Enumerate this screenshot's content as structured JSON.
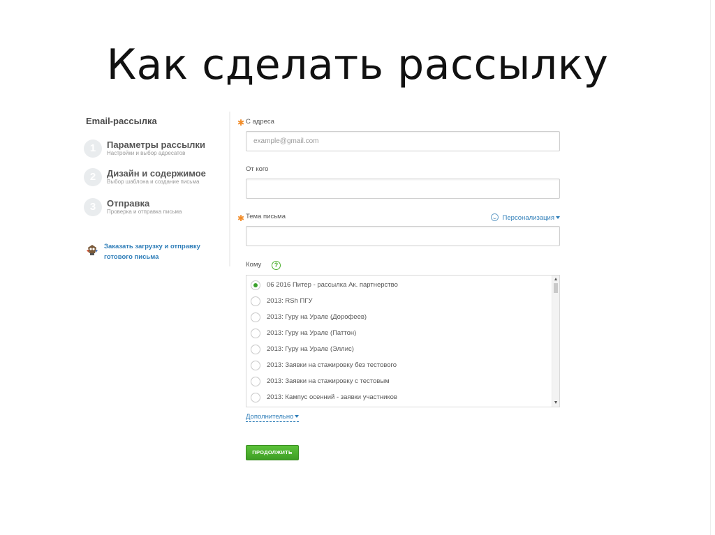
{
  "slide": {
    "title": "Как сделать рассылку"
  },
  "sidebar": {
    "title": "Email-рассылка",
    "steps": [
      {
        "number": "1",
        "title": "Параметры рассылки",
        "subtitle": "Настройки и выбор адресатов"
      },
      {
        "number": "2",
        "title": "Дизайн и содержимое",
        "subtitle": "Выбор шаблона и создание письма"
      },
      {
        "number": "3",
        "title": "Отправка",
        "subtitle": "Проверка и отправка письма"
      }
    ],
    "order_link": {
      "line1": "Заказать загрузку и отправку",
      "line2": "готового письма",
      "icon": "robot-icon"
    }
  },
  "form": {
    "from_address": {
      "label": "С адреса",
      "placeholder": "example@gmail.com",
      "required": true
    },
    "from_name": {
      "label": "От кого",
      "value": ""
    },
    "subject": {
      "label": "Тема письма",
      "value": "",
      "required": true
    },
    "personalization": {
      "label": "Персонализация",
      "icon": "smile-icon"
    },
    "recipients": {
      "label": "Кому",
      "help": "?",
      "items": [
        {
          "label": "06 2016 Питер - рассылка Ак. партнерство",
          "checked": true
        },
        {
          "label": "2013: RSh ПГУ",
          "checked": false
        },
        {
          "label": "2013: Гуру на Урале (Дорофеев)",
          "checked": false
        },
        {
          "label": "2013: Гуру на Урале (Паттон)",
          "checked": false
        },
        {
          "label": "2013: Гуру на Урале (Эллис)",
          "checked": false
        },
        {
          "label": "2013: Заявки на стажировку без тестового",
          "checked": false
        },
        {
          "label": "2013: Заявки на стажировку с тестовым",
          "checked": false
        },
        {
          "label": "2013: Кампус осенний - заявки участников",
          "checked": false
        }
      ]
    },
    "more_link": "Дополнительно",
    "continue_button": "ПРОДОЛЖИТЬ"
  },
  "colors": {
    "accent_green": "#3aa12b",
    "link_blue": "#2e7db8",
    "required_orange": "#f28c28"
  }
}
